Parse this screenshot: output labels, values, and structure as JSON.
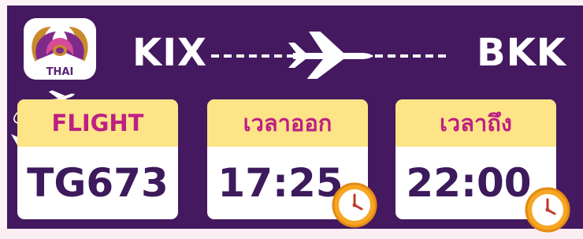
{
  "route": {
    "origin_code": "KIX",
    "destination_code": "BKK"
  },
  "logo": {
    "text": "THAI"
  },
  "cards": [
    {
      "label": "FLIGHT",
      "value": "TG673"
    },
    {
      "label": "เวลาออก",
      "value": "17:25"
    },
    {
      "label": "เวลาถึง",
      "value": "22:00"
    }
  ],
  "colors": {
    "background": "#44195f",
    "header_yellow": "#fde487",
    "label_magenta": "#bd1f84",
    "value_purple": "#3d1a5c"
  }
}
